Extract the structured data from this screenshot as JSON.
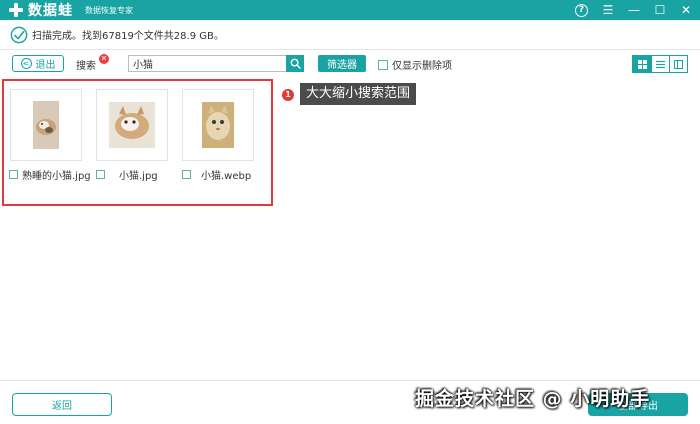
{
  "app": {
    "title": "数据蛙",
    "subtitle": "数据恢复专家"
  },
  "window_controls": {
    "help": "?",
    "menu": "☰",
    "minimize": "—",
    "maximize": "☐",
    "close": "✕"
  },
  "status": {
    "text": "扫描完成。找到67819个文件共28.9 GB。"
  },
  "toolbar": {
    "exit_label": "退出",
    "search_label": "搜索",
    "search_badge": "✕",
    "search_value": "小猫",
    "filter_label": "筛选器",
    "only_deleted_label": "仅显示删除项"
  },
  "files": [
    {
      "name": "熟睡的小猫.jpg"
    },
    {
      "name": "小猫.jpg"
    },
    {
      "name": "小猫.webp"
    }
  ],
  "annotation": {
    "badge": "1",
    "text": "大大缩小搜索范围"
  },
  "bottom": {
    "back_label": "返回",
    "recover_label": "全部导出"
  },
  "watermark": "掘金技术社区 @ 小明助手",
  "colors": {
    "accent": "#1aa3a3",
    "highlight": "#e23a3a"
  }
}
